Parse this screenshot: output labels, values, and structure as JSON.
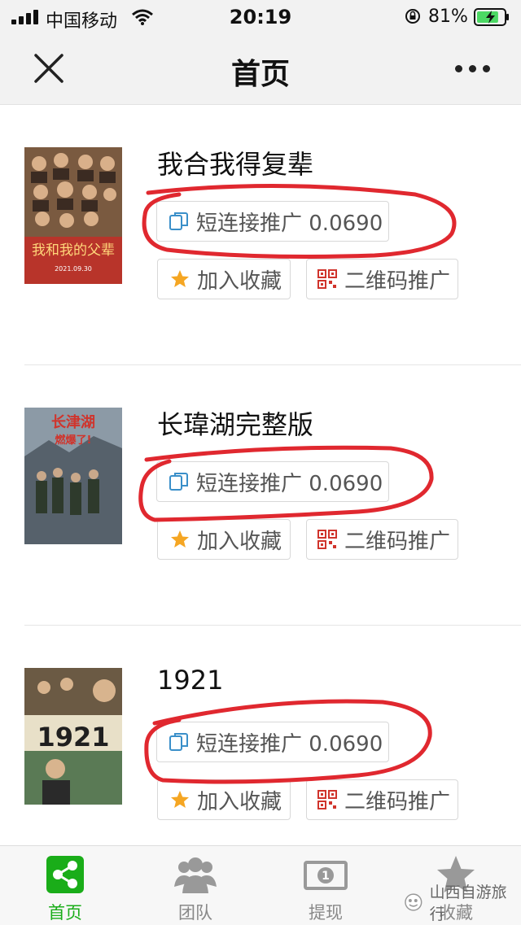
{
  "status_bar": {
    "carrier": "中国移动",
    "time": "20:19",
    "battery_percent": "81%",
    "battery_level": 0.81
  },
  "nav": {
    "title": "首页",
    "close_icon": "close-icon",
    "more_icon": "more-dots-icon"
  },
  "items": [
    {
      "title": "我合我得复辈",
      "short_link_label": "短连接推广 0.0690",
      "favorite_label": "加入收藏",
      "qr_label": "二维码推广",
      "poster_text": "我和我的父辈",
      "poster_date": "2021.09.30"
    },
    {
      "title": "长瑋湖完整版",
      "short_link_label": "短连接推广 0.0690",
      "favorite_label": "加入收藏",
      "qr_label": "二维码推广",
      "poster_text": "长津湖",
      "poster_subtext": "燃爆了!"
    },
    {
      "title": "1921",
      "short_link_label": "短连接推广 0.0690",
      "favorite_label": "加入收藏",
      "qr_label": "二维码推广",
      "poster_text": "1921"
    }
  ],
  "tabs": [
    {
      "label": "首页",
      "icon": "share-icon"
    },
    {
      "label": "团队",
      "icon": "team-icon"
    },
    {
      "label": "提现",
      "icon": "cash-icon"
    },
    {
      "label": "收藏",
      "icon": "star-icon"
    }
  ],
  "watermark": "山西自游旅行",
  "colors": {
    "accent_green": "#1aad19",
    "scribble_red": "#e0282f",
    "link_icon_blue": "#3a8fc9",
    "star_orange": "#f5a623",
    "qr_red": "#d0342c"
  }
}
